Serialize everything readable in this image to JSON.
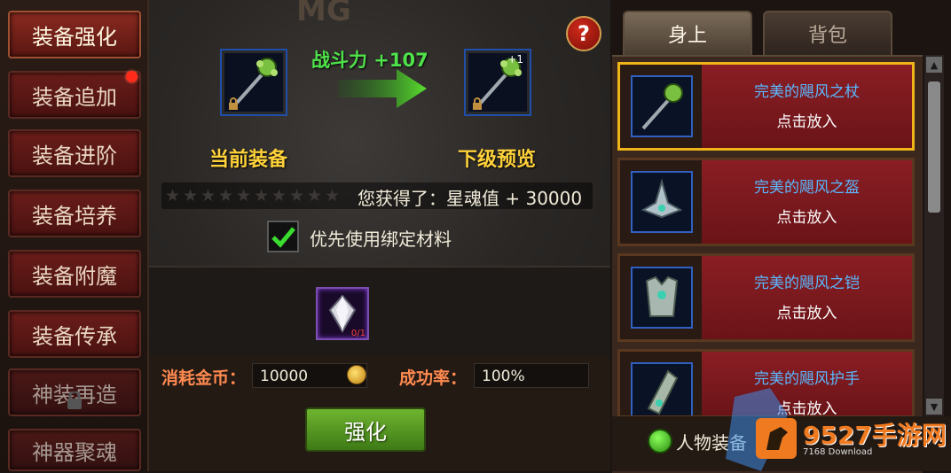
{
  "left_menu": {
    "items": [
      {
        "label": "装备强化"
      },
      {
        "label": "装备追加"
      },
      {
        "label": "装备进阶"
      },
      {
        "label": "装备培养"
      },
      {
        "label": "装备附魔"
      },
      {
        "label": "装备传承"
      },
      {
        "label": "神装再造"
      },
      {
        "label": "神器聚魂"
      }
    ]
  },
  "center": {
    "watermark": "MG",
    "help_label": "?",
    "power_change": "战斗力 +107",
    "current_label": "当前装备",
    "next_label": "下级预览",
    "next_level_badge": "+1",
    "stars_total": 10,
    "stars_filled": 0,
    "gain_text": "您获得了：星魂值 + 30000",
    "checkbox_checked": true,
    "checkbox_label": "优先使用绑定材料",
    "material_count": "0/1",
    "cost_label": "消耗金币：",
    "cost_value": "10000",
    "success_label": "成功率：",
    "success_value": "100%",
    "enhance_button": "强化"
  },
  "right": {
    "tabs": [
      {
        "label": "身上",
        "active": true
      },
      {
        "label": "背包",
        "active": false
      }
    ],
    "items": [
      {
        "name": "完美的飓风之杖",
        "action": "点击放入",
        "icon": "staff-icon",
        "selected": true
      },
      {
        "name": "完美的飓风之盔",
        "action": "点击放入",
        "icon": "helmet-icon",
        "selected": false
      },
      {
        "name": "完美的飓风之铠",
        "action": "点击放入",
        "icon": "armor-icon",
        "selected": false
      },
      {
        "name": "完美的飓风护手",
        "action": "点击放入",
        "icon": "gauntlet-icon",
        "selected": false
      }
    ],
    "bottom_label": "人物装备",
    "scroll_up": "▲",
    "scroll_down": "▼"
  },
  "watermark_site": {
    "text": "9527手游网",
    "sub": "7168 Download"
  },
  "colors": {
    "gold_label": "#ffd23a",
    "power_green": "#4fe24a",
    "item_name_blue": "#5ab8ff",
    "selected_border": "#f0b418",
    "menu_red": "#6a1d1a"
  }
}
